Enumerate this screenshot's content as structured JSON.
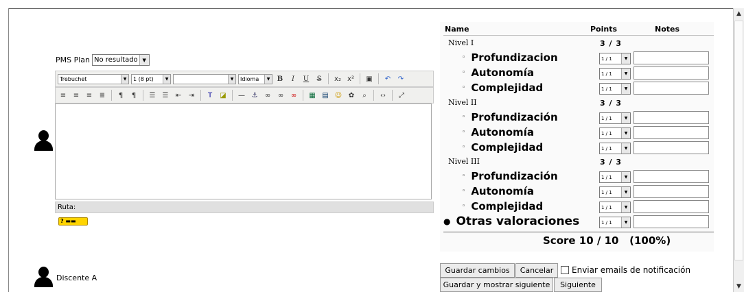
{
  "pms": {
    "label": "PMS Plan",
    "select_value": "No resultado"
  },
  "toolbar": {
    "font": "Trebuchet",
    "size": "1 (8 pt)",
    "style": "",
    "language": "Idioma"
  },
  "editor": {
    "path_label": "Ruta:"
  },
  "student": {
    "name": "Discente A"
  },
  "grading": {
    "col_name": "Name",
    "col_points": "Points",
    "col_notes": "Notes",
    "levels": [
      {
        "label": "Nivel I",
        "score": "3 / 3",
        "criteria": [
          {
            "name": "Profundizacion",
            "points": "1 / 1"
          },
          {
            "name": "Autonomía",
            "points": "1 / 1"
          },
          {
            "name": "Complejidad",
            "points": "1 / 1"
          }
        ]
      },
      {
        "label": "Nivel II",
        "score": "3 / 3",
        "criteria": [
          {
            "name": "Profundización",
            "points": "1 / 1"
          },
          {
            "name": "Autonomía",
            "points": "1 / 1"
          },
          {
            "name": "Complejidad",
            "points": "1 / 1"
          }
        ]
      },
      {
        "label": "Nivel III",
        "score": "3 / 3",
        "criteria": [
          {
            "name": "Profundización",
            "points": "1 / 1"
          },
          {
            "name": "Autonomía",
            "points": "1 / 1"
          },
          {
            "name": "Complejidad",
            "points": "1 / 1"
          }
        ]
      }
    ],
    "other": {
      "name": "Otras valoraciones",
      "points": "1 / 1"
    },
    "score": "Score 10 / 10   (100%)"
  },
  "actions": {
    "save": "Guardar cambios",
    "cancel": "Cancelar",
    "notify": "Enviar emails de notificación",
    "save_next": "Guardar y mostrar siguiente",
    "next": "Siguiente"
  }
}
